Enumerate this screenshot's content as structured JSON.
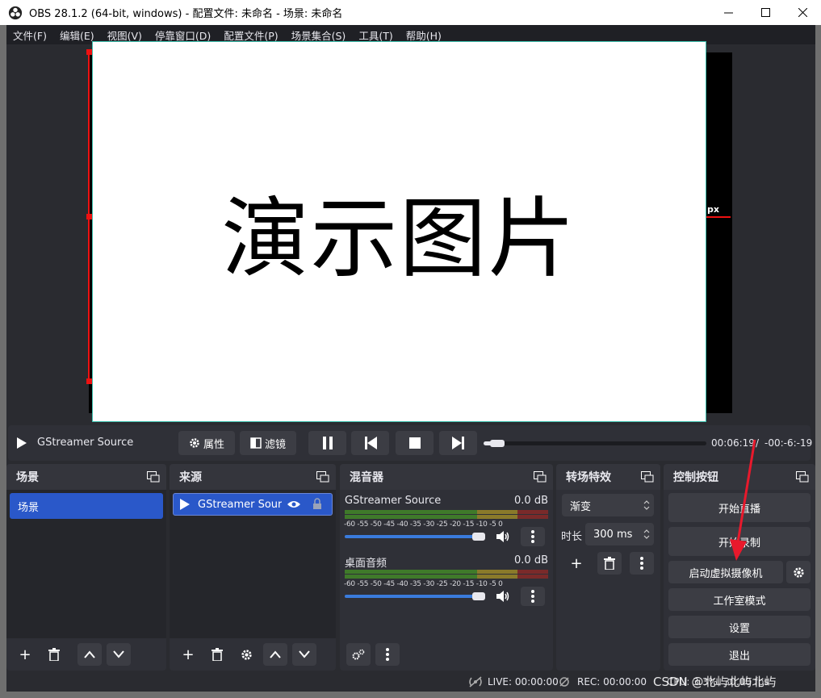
{
  "window": {
    "title": "OBS 28.1.2 (64-bit, windows) - 配置文件: 未命名 - 场景: 未命名"
  },
  "menu": [
    {
      "label": "文件(F)"
    },
    {
      "label": "编辑(E)"
    },
    {
      "label": "视图(V)"
    },
    {
      "label": "停靠窗口(D)"
    },
    {
      "label": "配置文件(P)"
    },
    {
      "label": "场景集合(S)"
    },
    {
      "label": "工具(T)"
    },
    {
      "label": "帮助(H)"
    }
  ],
  "preview": {
    "image_text": "演示图片",
    "size_label": "px"
  },
  "media": {
    "source_name": "GStreamer Source",
    "properties_label": "属性",
    "filters_label": "滤镜",
    "time_elapsed": "00:06:19",
    "time_separator": "/",
    "time_remaining": "-00:-6:-19",
    "progress": 0.03
  },
  "scenes": {
    "title": "场景",
    "items": [
      {
        "label": "场景"
      }
    ]
  },
  "sources": {
    "title": "来源",
    "items": [
      {
        "label": "GStreamer Source"
      }
    ]
  },
  "mixer": {
    "title": "混音器",
    "channels": [
      {
        "name": "GStreamer Source",
        "level": "0.0 dB",
        "volume": 1.0
      },
      {
        "name": "桌面音频",
        "level": "0.0 dB",
        "volume": 1.0
      }
    ],
    "ticks": [
      "-60",
      "-55",
      "-50",
      "-45",
      "-40",
      "-35",
      "-30",
      "-25",
      "-20",
      "-15",
      "-10",
      "-5",
      "0"
    ]
  },
  "transitions": {
    "title": "转场特效",
    "selected": "渐变",
    "duration_label": "时长",
    "duration_value": "300 ms"
  },
  "controls": {
    "title": "控制按钮",
    "start_streaming": "开始直播",
    "start_recording": "开始录制",
    "start_virtual_cam": "启动虚拟摄像机",
    "studio_mode": "工作室模式",
    "settings": "设置",
    "exit": "退出"
  },
  "status": {
    "live": "LIVE: 00:00:00",
    "rec": "REC: 00:00:00",
    "cpu": "CPU: 3.3%, 30.00 fps",
    "watermark": "CSDN @北屿北屿北屿"
  },
  "colors": {
    "accent": "#2a58c9",
    "panel": "#2f3037",
    "panel_body": "#25262b",
    "button": "#3c3d44",
    "annotation_arrow": "#e8192c"
  }
}
